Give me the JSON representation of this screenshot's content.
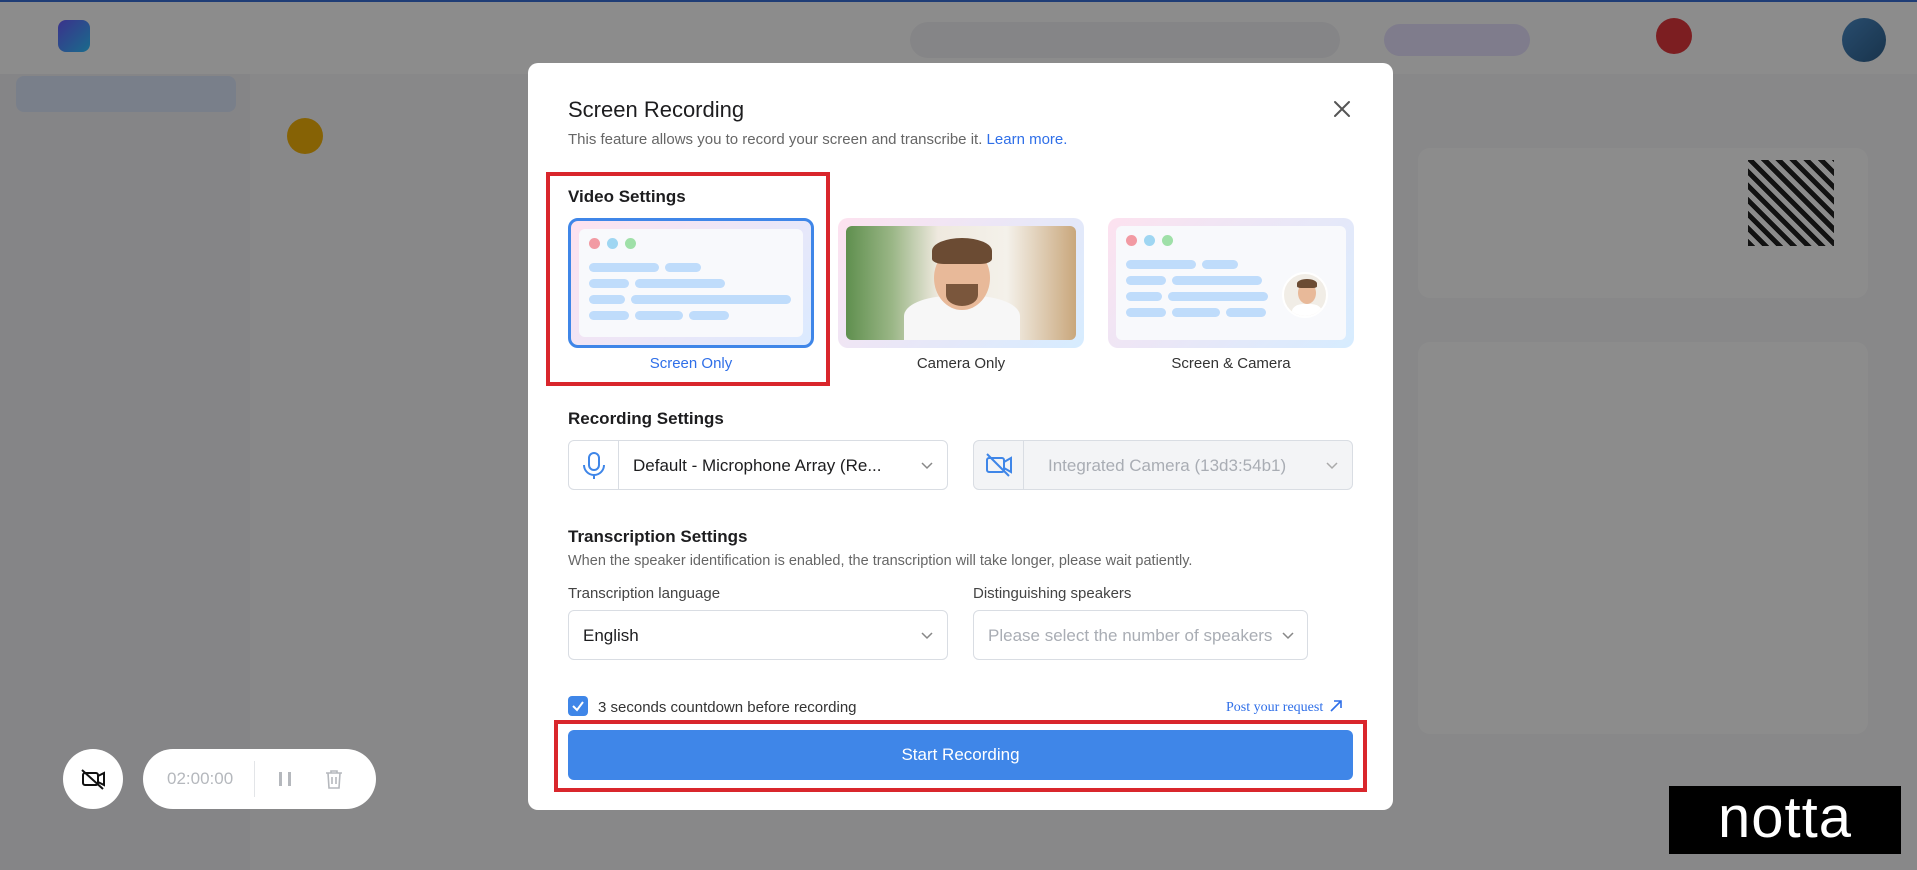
{
  "modal": {
    "title": "Screen Recording",
    "subtitle": "This feature allows you to record your screen and transcribe it.",
    "learn_more": "Learn more."
  },
  "video_settings": {
    "title": "Video Settings",
    "options": [
      {
        "label": "Screen Only",
        "selected": true
      },
      {
        "label": "Camera Only",
        "selected": false
      },
      {
        "label": "Screen & Camera",
        "selected": false
      }
    ]
  },
  "recording_settings": {
    "title": "Recording Settings",
    "microphone": "Default - Microphone Array (Re...",
    "camera": "Integrated Camera (13d3:54b1)"
  },
  "transcription_settings": {
    "title": "Transcription Settings",
    "help": "When the speaker identification is enabled, the transcription will take longer, please wait patiently.",
    "language_label": "Transcription language",
    "language_value": "English",
    "speakers_label": "Distinguishing speakers",
    "speakers_placeholder": "Please select the number of speakers"
  },
  "countdown": {
    "label": "3 seconds countdown before recording",
    "checked": true
  },
  "post_request": "Post your request",
  "start_button": "Start Recording",
  "recorder": {
    "timer": "02:00:00"
  },
  "watermark": "notta",
  "colors": {
    "accent": "#3f86e8",
    "highlight": "#d9262c"
  }
}
